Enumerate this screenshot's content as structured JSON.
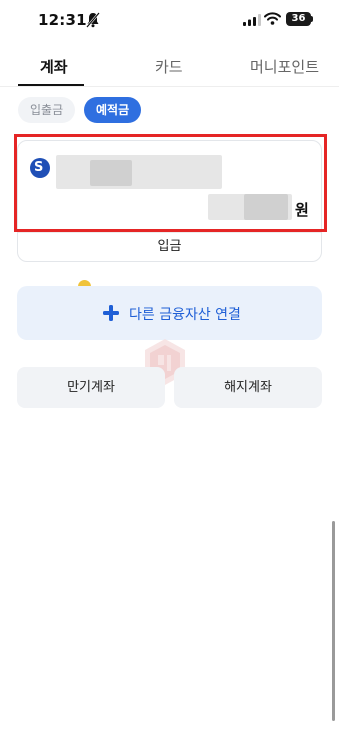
{
  "status_bar": {
    "time": "12:31",
    "battery": "36"
  },
  "tabs": [
    {
      "label": "계좌",
      "active": true
    },
    {
      "label": "카드",
      "active": false
    },
    {
      "label": "머니포인트",
      "active": false
    }
  ],
  "filters": [
    {
      "label": "입출금",
      "active": false
    },
    {
      "label": "예적금",
      "active": true
    }
  ],
  "account_card": {
    "bank_logo_glyph": "S",
    "balance_unit": "원",
    "deposit_label": "입금",
    "highlight_color": "#e52525"
  },
  "link_assets": {
    "label": "다른 금융자산 연결"
  },
  "buttons": {
    "maturity": "만기계좌",
    "closed": "해지계좌"
  },
  "colors": {
    "accent": "#2f6fe0",
    "link": "#1f5fd6",
    "link_bg": "#eaf1fb"
  }
}
